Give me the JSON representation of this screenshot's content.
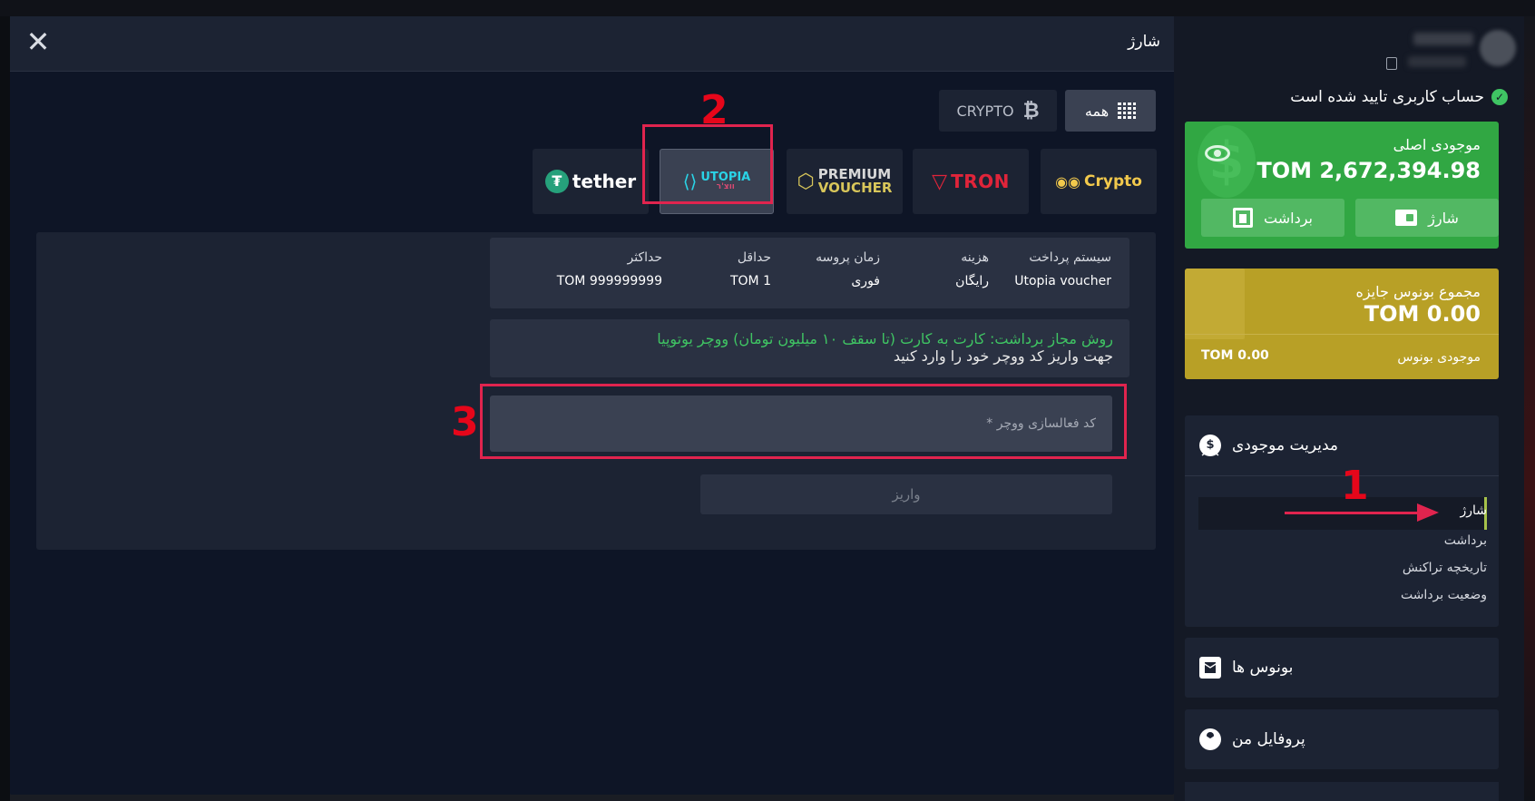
{
  "modal": {
    "title": "شارژ",
    "close_label": "✕"
  },
  "filters": {
    "all_label": "همه",
    "crypto_label": "CRYPTO"
  },
  "providers": {
    "crypto": "Crypto",
    "tron": "TRON",
    "premium_top": "PREMIUM",
    "premium_bottom": "VOUCHER",
    "utopia_top": "UTOPIA",
    "utopia_bottom": "ווצ'ר",
    "tether": "tether"
  },
  "info": {
    "payment_system_header": "سیستم پرداخت",
    "payment_system_value": "Utopia voucher",
    "fee_header": "هزینه",
    "fee_value": "رایگان",
    "process_time_header": "زمان پروسه",
    "process_time_value": "فوری",
    "min_header": "حداقل",
    "min_value": "TOM 1",
    "max_header": "حداکثر",
    "max_value": "TOM 999999999"
  },
  "note": {
    "green": "روش مجاز برداشت: کارت به کارت (تا سقف ۱۰ میلیون تومان) ووچر یوتوپیا",
    "white": "جهت واریز کد ووچر خود را وارد کنید"
  },
  "voucher_input": {
    "placeholder": "کد فعالسازی ووچر *",
    "value": ""
  },
  "deposit_button": "واریز",
  "annotations": {
    "one": "1",
    "two": "2",
    "three": "3"
  },
  "sidebar": {
    "verified_text": "حساب کاربری تایید شده است",
    "main_balance_label": "موجودی اصلی",
    "main_balance_value": "TOM 2,672,394.98",
    "charge_button": "شارژ",
    "withdraw_button": "برداشت",
    "bonus_total_label": "مجموع بونوس جایزه",
    "bonus_total_value": "TOM 0.00",
    "bonus_balance_label": "موجودی بونوس",
    "bonus_balance_value": "TOM 0.00",
    "sections": {
      "manage": "مدیریت موجودی",
      "bonuses": "بونوس ها",
      "profile": "پروفایل من"
    },
    "manage_items": [
      "شارژ",
      "برداشت",
      "تاریخچه تراکنش",
      "وضعیت برداشت"
    ]
  },
  "colors": {
    "accent_red": "#e0244e",
    "balance_green": "#31a743",
    "bonus_gold": "#b8a026",
    "note_green": "#3fc463"
  }
}
